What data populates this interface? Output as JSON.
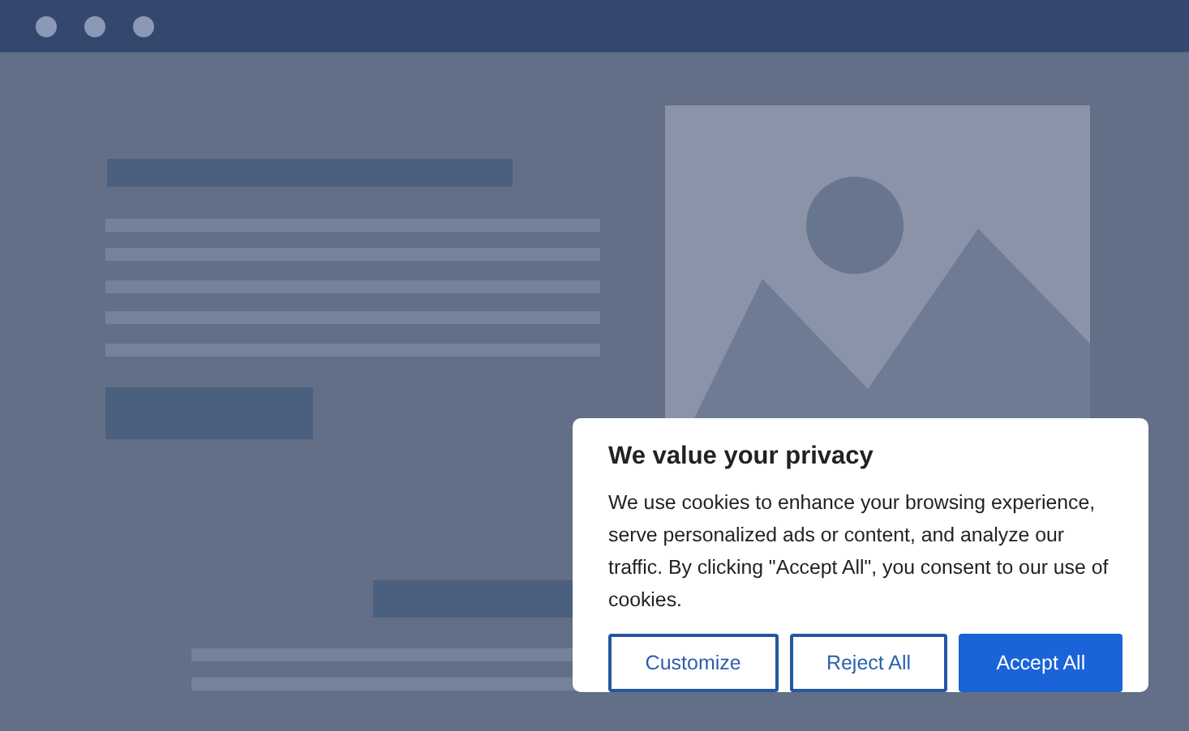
{
  "cookie_dialog": {
    "title": "We value your privacy",
    "message": "We use cookies to enhance your browsing experience, serve personalized ads or content, and analyze our traffic. By clicking \"Accept All\", you consent to our use of cookies.",
    "buttons": [
      {
        "label": "Customize",
        "kind": "outline"
      },
      {
        "label": "Reject All",
        "kind": "outline"
      },
      {
        "label": "Accept All",
        "kind": "primary"
      }
    ]
  }
}
